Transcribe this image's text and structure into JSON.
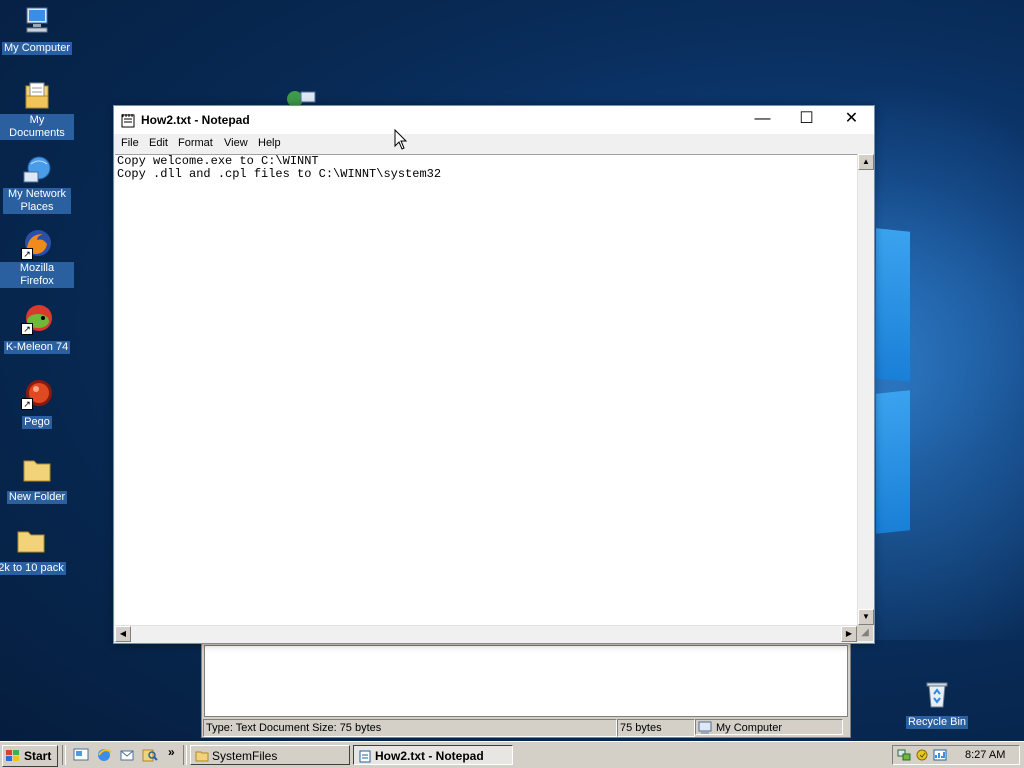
{
  "desktop": {
    "icons": [
      {
        "label": "My Computer",
        "icon": "computer-icon"
      },
      {
        "label": "My Documents",
        "icon": "documents-icon"
      },
      {
        "label": "My Network Places",
        "icon": "network-icon"
      },
      {
        "label": "Mozilla Firefox",
        "icon": "firefox-icon"
      },
      {
        "label": "K-Meleon 74",
        "icon": "kmeleon-icon"
      },
      {
        "label": "Pego",
        "icon": "pego-icon"
      },
      {
        "label": "New Folder",
        "icon": "folder-icon"
      },
      {
        "label": "2k to 10 pack",
        "icon": "folder-icon"
      },
      {
        "label": "Recycle Bin",
        "icon": "recycle-bin-icon"
      }
    ]
  },
  "explorer": {
    "status": {
      "type_info": "Type: Text Document Size: 75 bytes",
      "size": "75 bytes",
      "zone": "My Computer"
    }
  },
  "notepad": {
    "title": "How2.txt - Notepad",
    "menu": [
      "File",
      "Edit",
      "Format",
      "View",
      "Help"
    ],
    "lines": [
      "Copy welcome.exe to C:\\WINNT",
      "Copy .dll and .cpl files to C:\\WINNT\\system32"
    ],
    "caption_buttons": {
      "minimize": "—",
      "maximize": "☐",
      "close": "✕"
    }
  },
  "taskbar": {
    "start_label": "Start",
    "quicklaunch_more": "»",
    "buttons": [
      {
        "label": "SystemFiles",
        "icon": "folder-icon",
        "active": false
      },
      {
        "label": "How2.txt - Notepad",
        "icon": "notepad-icon",
        "active": true
      }
    ],
    "clock": "8:27 AM"
  },
  "colors": {
    "desktop_bg": "#082a55",
    "label_bg": "#2a5fa0",
    "window_frame": "#6f8fb5",
    "taskbar_bg": "#d4d0c8"
  }
}
